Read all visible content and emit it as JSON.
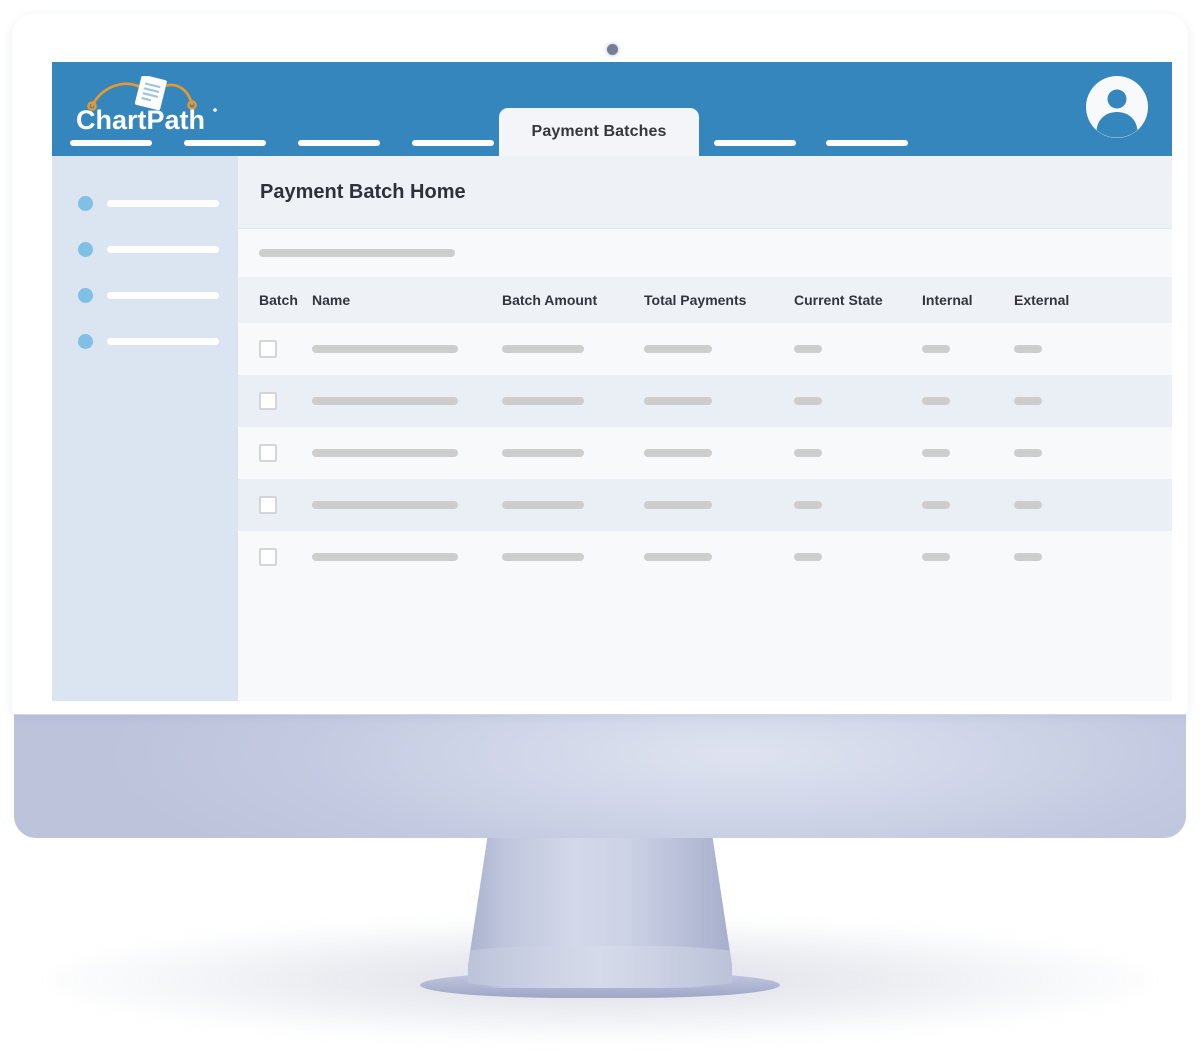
{
  "app": {
    "logo_text": "ChartPath",
    "logo_mark": "document-path-logo",
    "header_color": "#3486bd",
    "accent_color": "#e8992e"
  },
  "header": {
    "nav_placeholders_left": [
      {
        "name": "nav-placeholder-1"
      },
      {
        "name": "nav-placeholder-2"
      },
      {
        "name": "nav-placeholder-3"
      },
      {
        "name": "nav-placeholder-4"
      }
    ],
    "active_tab": "Payment Batches",
    "nav_placeholders_right": [
      {
        "name": "nav-placeholder-5"
      },
      {
        "name": "nav-placeholder-6"
      }
    ],
    "avatar_icon": "user-avatar-icon"
  },
  "sidebar": {
    "background": "#dbe5f1",
    "dot_color": "#81c0e4",
    "items": [
      {
        "name": "sidebar-item-1"
      },
      {
        "name": "sidebar-item-2"
      },
      {
        "name": "sidebar-item-3"
      },
      {
        "name": "sidebar-item-4"
      }
    ]
  },
  "main": {
    "page_title": "Payment Batch Home",
    "toolbar_placeholder": "toolbar-skeleton-bar",
    "table": {
      "columns": [
        "Batch",
        "Name",
        "Batch Amount",
        "Total Payments",
        "Current State",
        "Internal",
        "External"
      ],
      "rows": [
        {
          "checkbox": false
        },
        {
          "checkbox": false
        },
        {
          "checkbox": false
        },
        {
          "checkbox": false
        },
        {
          "checkbox": false
        }
      ]
    }
  },
  "device": {
    "camera_icon": "camera-dot-icon",
    "bezel_color": "#ffffff",
    "chin_color": "#c8cee4"
  }
}
